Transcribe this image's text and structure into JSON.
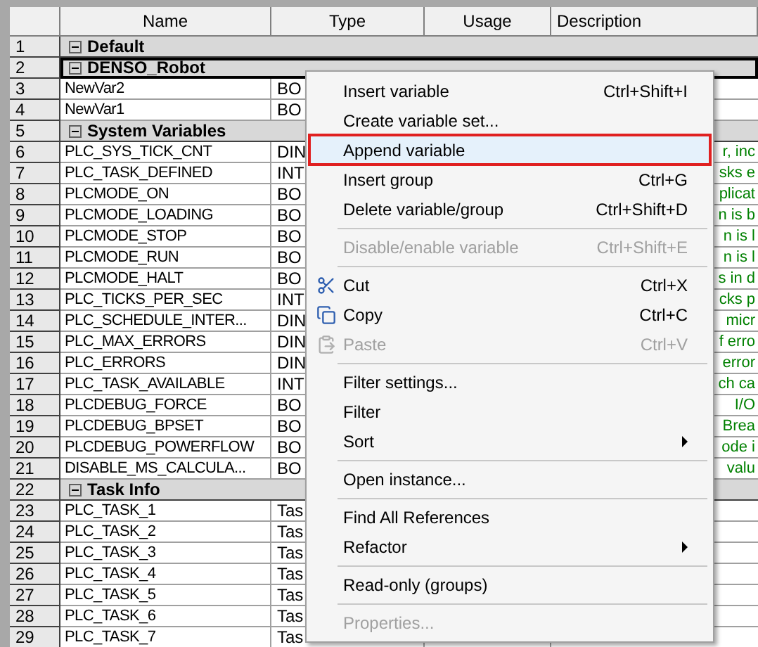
{
  "table": {
    "columns": [
      "Name",
      "Type",
      "Usage",
      "Description"
    ],
    "rows": [
      {
        "number": "1",
        "kind": "group",
        "name": "Default",
        "selected": false
      },
      {
        "number": "2",
        "kind": "group",
        "name": "DENSO_Robot",
        "selected": true
      },
      {
        "number": "3",
        "kind": "variable",
        "name": "NewVar2",
        "type": "BO",
        "selected": false
      },
      {
        "number": "4",
        "kind": "variable",
        "name": "NewVar1",
        "type": "BO",
        "selected": false
      },
      {
        "number": "5",
        "kind": "group",
        "name": "System Variables",
        "selected": false
      },
      {
        "number": "6",
        "kind": "variable",
        "name": "PLC_SYS_TICK_CNT",
        "type": "DIN",
        "description": "r, inc",
        "selected": false
      },
      {
        "number": "7",
        "kind": "variable",
        "name": "PLC_TASK_DEFINED",
        "type": "INT",
        "description": "sks e",
        "selected": false
      },
      {
        "number": "8",
        "kind": "variable",
        "name": "PLCMODE_ON",
        "type": "BO",
        "description": "plicat",
        "selected": false
      },
      {
        "number": "9",
        "kind": "variable",
        "name": "PLCMODE_LOADING",
        "type": "BO",
        "description": "n is b",
        "selected": false
      },
      {
        "number": "10",
        "kind": "variable",
        "name": "PLCMODE_STOP",
        "type": "BO",
        "description": "n is l",
        "selected": false
      },
      {
        "number": "11",
        "kind": "variable",
        "name": "PLCMODE_RUN",
        "type": "BO",
        "description": "n is l",
        "selected": false
      },
      {
        "number": "12",
        "kind": "variable",
        "name": "PLCMODE_HALT",
        "type": "BO",
        "description": "s in d",
        "selected": false
      },
      {
        "number": "13",
        "kind": "variable",
        "name": "PLC_TICKS_PER_SEC",
        "type": "INT",
        "description": "cks p",
        "selected": false
      },
      {
        "number": "14",
        "kind": "variable",
        "name": "PLC_SCHEDULE_INTER...",
        "type": "DIN",
        "description": "micr",
        "selected": false
      },
      {
        "number": "15",
        "kind": "variable",
        "name": "PLC_MAX_ERRORS",
        "type": "DIN",
        "description": "f erro",
        "selected": false
      },
      {
        "number": "16",
        "kind": "variable",
        "name": "PLC_ERRORS",
        "type": "DIN",
        "description": "error",
        "selected": false
      },
      {
        "number": "17",
        "kind": "variable",
        "name": "PLC_TASK_AVAILABLE",
        "type": "INT",
        "description": "ch ca",
        "selected": false
      },
      {
        "number": "18",
        "kind": "variable",
        "name": "PLCDEBUG_FORCE",
        "type": "BO",
        "description": "I/O",
        "selected": false
      },
      {
        "number": "19",
        "kind": "variable",
        "name": "PLCDEBUG_BPSET",
        "type": "BO",
        "description": "Brea",
        "selected": false
      },
      {
        "number": "20",
        "kind": "variable",
        "name": "PLCDEBUG_POWERFLOW",
        "type": "BO",
        "description": "ode i",
        "selected": false
      },
      {
        "number": "21",
        "kind": "variable",
        "name": "DISABLE_MS_CALCULA...",
        "type": "BO",
        "description": "valu",
        "selected": false
      },
      {
        "number": "22",
        "kind": "group",
        "name": "Task Info",
        "selected": false
      },
      {
        "number": "23",
        "kind": "variable",
        "name": "PLC_TASK_1",
        "type": "Tas",
        "selected": false
      },
      {
        "number": "24",
        "kind": "variable",
        "name": "PLC_TASK_2",
        "type": "Tas",
        "selected": false
      },
      {
        "number": "25",
        "kind": "variable",
        "name": "PLC_TASK_3",
        "type": "Tas",
        "selected": false
      },
      {
        "number": "26",
        "kind": "variable",
        "name": "PLC_TASK_4",
        "type": "Tas",
        "selected": false
      },
      {
        "number": "27",
        "kind": "variable",
        "name": "PLC_TASK_5",
        "type": "Tas",
        "selected": false
      },
      {
        "number": "28",
        "kind": "variable",
        "name": "PLC_TASK_6",
        "type": "Tas",
        "selected": false
      },
      {
        "number": "29",
        "kind": "variable",
        "name": "PLC_TASK_7",
        "type": "Tas",
        "selected": false
      }
    ]
  },
  "context_menu": {
    "items": [
      {
        "kind": "item",
        "label": "Insert variable",
        "shortcut": "Ctrl+Shift+I",
        "disabled": false,
        "selected": false
      },
      {
        "kind": "item",
        "label": "Create variable set...",
        "disabled": false,
        "selected": false
      },
      {
        "kind": "item",
        "label": "Append variable",
        "disabled": false,
        "selected": true
      },
      {
        "kind": "item",
        "label": "Insert group",
        "shortcut": "Ctrl+G",
        "disabled": false,
        "selected": false
      },
      {
        "kind": "item",
        "label": "Delete variable/group",
        "shortcut": "Ctrl+Shift+D",
        "disabled": false,
        "selected": false
      },
      {
        "kind": "separator"
      },
      {
        "kind": "item",
        "label": "Disable/enable variable",
        "shortcut": "Ctrl+Shift+E",
        "disabled": true,
        "selected": false
      },
      {
        "kind": "separator"
      },
      {
        "kind": "cut",
        "label": "Cut",
        "shortcut": "Ctrl+X",
        "disabled": false,
        "selected": false
      },
      {
        "kind": "copy",
        "label": "Copy",
        "shortcut": "Ctrl+C",
        "disabled": false,
        "selected": false
      },
      {
        "kind": "paste",
        "label": "Paste",
        "shortcut": "Ctrl+V",
        "disabled": true,
        "selected": false
      },
      {
        "kind": "separator"
      },
      {
        "kind": "item",
        "label": "Filter settings...",
        "disabled": false,
        "selected": false
      },
      {
        "kind": "item",
        "label": "Filter",
        "disabled": false,
        "selected": false
      },
      {
        "kind": "item",
        "label": "Sort",
        "submenu": true,
        "disabled": false,
        "selected": false
      },
      {
        "kind": "separator"
      },
      {
        "kind": "item",
        "label": "Open instance...",
        "disabled": false,
        "selected": false
      },
      {
        "kind": "separator"
      },
      {
        "kind": "item",
        "label": "Find All References",
        "disabled": false,
        "selected": false
      },
      {
        "kind": "item",
        "label": "Refactor",
        "submenu": true,
        "disabled": false,
        "selected": false
      },
      {
        "kind": "separator"
      },
      {
        "kind": "item",
        "label": "Read-only (groups)",
        "disabled": false,
        "selected": false
      },
      {
        "kind": "separator"
      },
      {
        "kind": "item",
        "label": "Properties...",
        "disabled": true,
        "selected": false
      }
    ]
  }
}
